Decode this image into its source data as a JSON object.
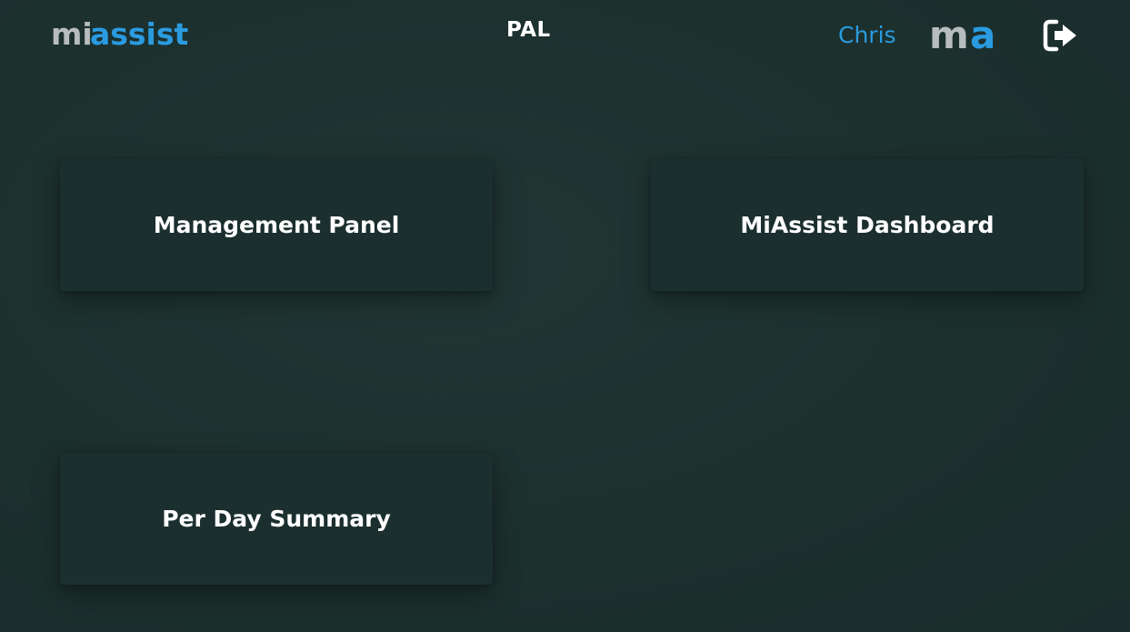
{
  "header": {
    "logo_text_grey": "mi",
    "logo_text_blue": "assist",
    "title": "PAL",
    "user_name": "Chris",
    "brand_mark_grey": "m",
    "brand_mark_blue": "a",
    "logout_icon": "sign-out-icon"
  },
  "cards": [
    {
      "label": "Management Panel"
    },
    {
      "label": "MiAssist Dashboard"
    },
    {
      "label": "Per Day Summary"
    }
  ],
  "colors": {
    "background": "#1c2f2e",
    "card": "#1b2f2e",
    "accent_blue": "#2a9be0",
    "logo_grey": "#b7bcbc",
    "text": "#ffffff"
  }
}
